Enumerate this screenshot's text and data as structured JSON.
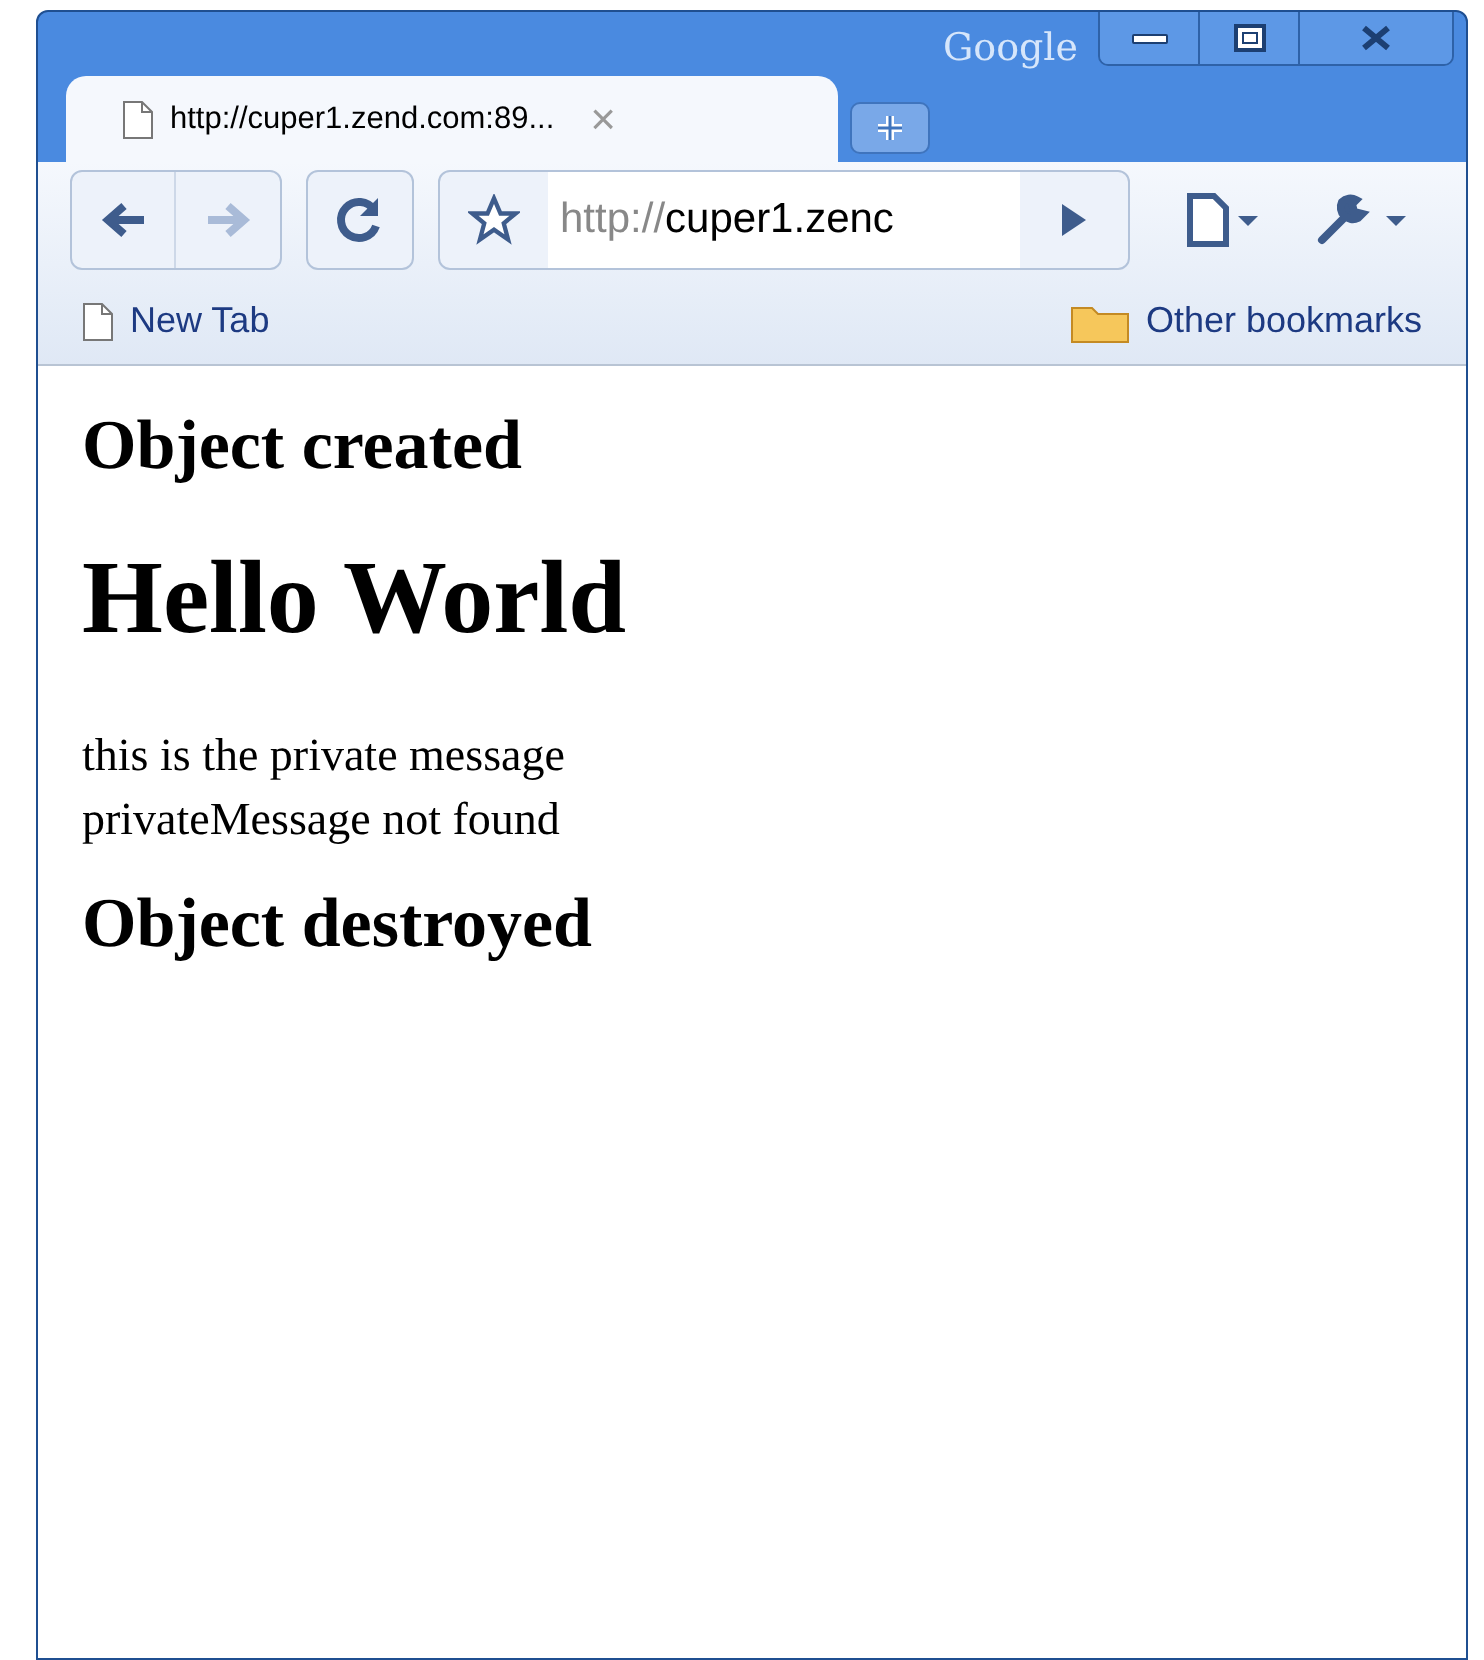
{
  "window": {
    "brand": "Google"
  },
  "tabs": [
    {
      "title": "http://cuper1.zend.com:89...",
      "close": "×",
      "selected": true
    }
  ],
  "toolbar": {
    "back_disabled": false,
    "forward_disabled": true,
    "address": {
      "scheme": "http://",
      "rest": "cuper1.zenc"
    }
  },
  "bookmarks": [
    {
      "label": "New Tab",
      "kind": "page"
    },
    {
      "label": "Other bookmarks",
      "kind": "folder"
    }
  ],
  "content": [
    {
      "kind": "h2",
      "text": "Object created"
    },
    {
      "kind": "h1",
      "text": "Hello World"
    },
    {
      "kind": "p",
      "lines": [
        "this is the private message",
        "privateMessage not found"
      ]
    },
    {
      "kind": "h2",
      "text": "Object destroyed"
    }
  ]
}
